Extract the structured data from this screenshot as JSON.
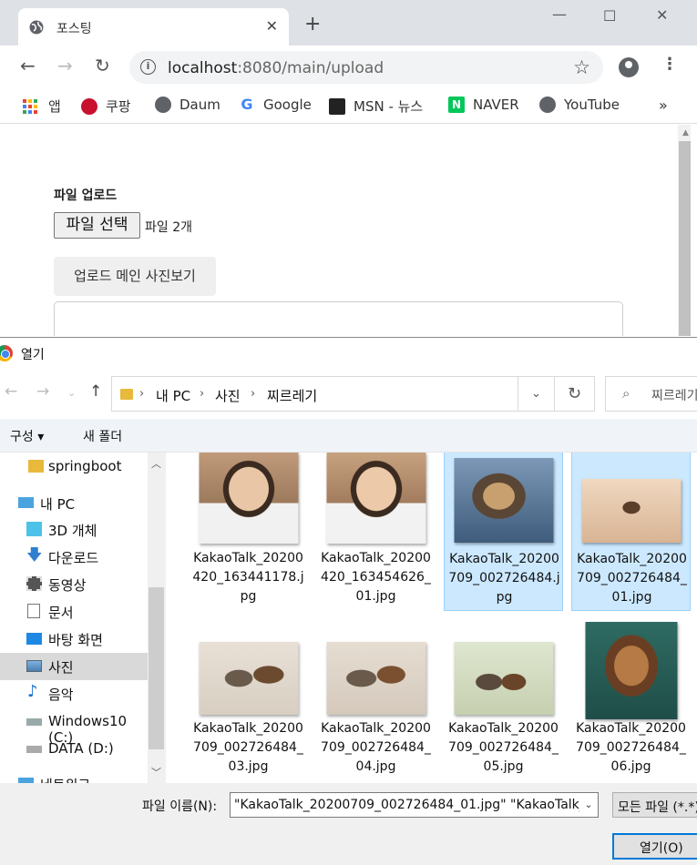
{
  "browser": {
    "tab_title": "포스팅",
    "url_host": "localhost",
    "url_rest": ":8080/main/upload",
    "bookmarks": [
      {
        "label": "앱",
        "icon": "apps-grid-icon"
      },
      {
        "label": "쿠팡",
        "icon": "coupang-icon"
      },
      {
        "label": "Daum",
        "icon": "globe-icon"
      },
      {
        "label": "Google",
        "icon": "google-icon"
      },
      {
        "label": "MSN - 뉴스",
        "icon": "msn-icon"
      },
      {
        "label": "NAVER",
        "icon": "naver-icon"
      },
      {
        "label": "YouTube",
        "icon": "globe-icon"
      }
    ],
    "more_bookmarks": "»"
  },
  "page": {
    "upload_heading": "파일 업로드",
    "file_button": "파일 선택",
    "file_count": "파일 2개",
    "view_button": "업로드 메인 사진보기"
  },
  "dialog": {
    "title": "열기",
    "breadcrumb": [
      "내 PC",
      "사진",
      "찌르레기"
    ],
    "search_placeholder": "찌르레기",
    "organize": "구성 ▾",
    "new_folder": "새 폴더",
    "nav_items": [
      {
        "label": "springboot",
        "icon": "folder-icon"
      },
      {
        "label": "내 PC",
        "icon": "computer-icon"
      },
      {
        "label": "3D 개체",
        "icon": "3d-objects-icon"
      },
      {
        "label": "다운로드",
        "icon": "download-icon"
      },
      {
        "label": "동영상",
        "icon": "video-icon"
      },
      {
        "label": "문서",
        "icon": "document-icon"
      },
      {
        "label": "바탕 화면",
        "icon": "desktop-icon"
      },
      {
        "label": "사진",
        "icon": "pictures-icon",
        "selected": true
      },
      {
        "label": "음악",
        "icon": "music-icon"
      },
      {
        "label": "Windows10 (C:)",
        "icon": "drive-icon"
      },
      {
        "label": "DATA (D:)",
        "icon": "drive-icon"
      },
      {
        "label": "네트워크",
        "icon": "network-icon"
      }
    ],
    "files": [
      {
        "name": "KakaoTalk_20200420_163441178.jpg",
        "selected": false
      },
      {
        "name": "KakaoTalk_20200420_163454626_01.jpg",
        "selected": false
      },
      {
        "name": "KakaoTalk_20200709_002726484.jpg",
        "selected": true
      },
      {
        "name": "KakaoTalk_20200709_002726484_01.jpg",
        "selected": true
      },
      {
        "name": "KakaoTalk_20200709_002726484_03.jpg",
        "selected": false
      },
      {
        "name": "KakaoTalk_20200709_002726484_04.jpg",
        "selected": false
      },
      {
        "name": "KakaoTalk_20200709_002726484_05.jpg",
        "selected": false
      },
      {
        "name": "KakaoTalk_20200709_002726484_06.jpg",
        "selected": false
      }
    ],
    "filename_label": "파일 이름(N):",
    "filename_value": "\"KakaoTalk_20200709_002726484_01.jpg\" \"KakaoTalk_20",
    "filter_value": "모든 파일 (*.*)",
    "open_button": "열기(O)"
  },
  "colors": {
    "selection_bg": "#cce8ff",
    "selection_border": "#99d1ff",
    "open_button_border": "#0078d7"
  }
}
